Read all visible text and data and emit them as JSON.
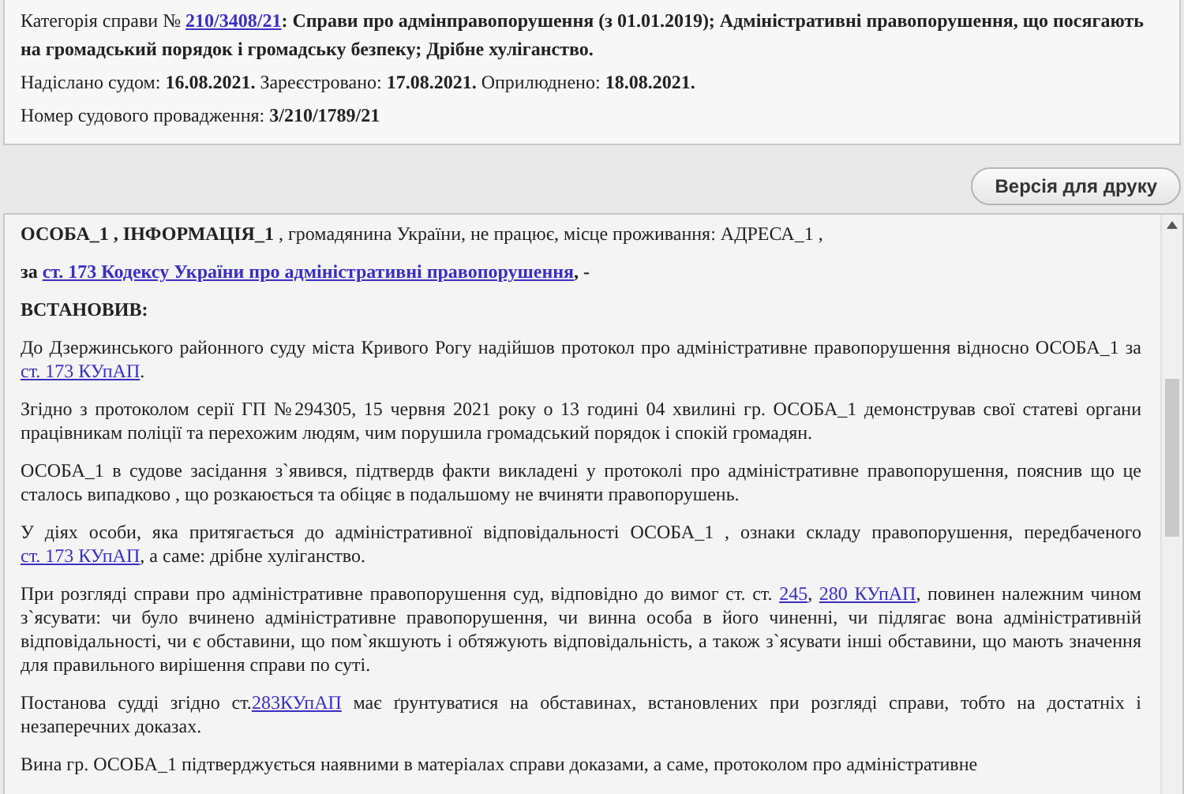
{
  "case_info": {
    "lines": [
      [
        {
          "kind": "text",
          "text": "Категорія справи № "
        },
        {
          "kind": "bold_link",
          "text": "210/3408/21"
        },
        {
          "kind": "bold",
          "text": ": Справи про адмінправопорушення (з 01.01.2019); Адміністративні правопорушення, що посягають на громадський порядок і громадську безпеку; Дрібне хуліганство."
        }
      ],
      [
        {
          "kind": "text",
          "text": "Надіслано судом: "
        },
        {
          "kind": "bold",
          "text": "16.08.2021."
        },
        {
          "kind": "text",
          "text": " Зареєстровано: "
        },
        {
          "kind": "bold",
          "text": "17.08.2021."
        },
        {
          "kind": "text",
          "text": " Оприлюднено: "
        },
        {
          "kind": "bold",
          "text": "18.08.2021."
        }
      ],
      [
        {
          "kind": "text",
          "text": "Номер судового провадження: "
        },
        {
          "kind": "bold",
          "text": "3/210/1789/21"
        }
      ]
    ]
  },
  "print_button": {
    "label": "Версія для друку"
  },
  "document": {
    "paragraphs": [
      [
        {
          "kind": "bold",
          "text": "ОСОБА_1 , ІНФОРМАЦІЯ_1"
        },
        {
          "kind": "text",
          "text": " , громадянина України, не працює, місце проживання: АДРЕСА_1 ,"
        }
      ],
      [
        {
          "kind": "bold",
          "text": "за "
        },
        {
          "kind": "bold_link",
          "text": "ст. 173 Кодексу України про адміністративні правопорушення"
        },
        {
          "kind": "bold",
          "text": ", -"
        }
      ],
      [
        {
          "kind": "bold",
          "text": "ВСТАНОВИВ:"
        }
      ],
      [
        {
          "kind": "text",
          "text": "До Дзержинського районного суду міста Кривого Рогу надійшов протокол про адміністративне правопорушення відносно ОСОБА_1 за "
        },
        {
          "kind": "link",
          "text": "ст. 173 КУпАП"
        },
        {
          "kind": "text",
          "text": "."
        }
      ],
      [
        {
          "kind": "text",
          "text": "Згідно з протоколом серії ГП №294305, 15 червня 2021 року о 13 годині 04 хвилині гр. ОСОБА_1 демонстрував свої статеві органи працівникам поліції та перехожим людям, чим порушила громадський порядок і спокій громадян."
        }
      ],
      [
        {
          "kind": "text",
          "text": "ОСОБА_1 в судове засідання з`явився, підтвердв факти викладені у протоколі про адміністративне правопорушення, пояснив що це сталось випадково , що розкаюється та обіцяє в подальшому не вчиняти правопорушень."
        }
      ],
      [
        {
          "kind": "text",
          "text": "У діях особи, яка притягається до адміністративної відповідальності ОСОБА_1 , ознаки складу правопорушення, передбаченого "
        },
        {
          "kind": "link",
          "text": "ст. 173 КУпАП"
        },
        {
          "kind": "text",
          "text": ", а саме: дрібне хуліганство."
        }
      ],
      [
        {
          "kind": "text",
          "text": "При розгляді справи про адміністративне правопорушення суд, відповідно до вимог ст. ст. "
        },
        {
          "kind": "link",
          "text": "245"
        },
        {
          "kind": "text",
          "text": ", "
        },
        {
          "kind": "link",
          "text": "280 КУпАП"
        },
        {
          "kind": "text",
          "text": ", повинен належним чином з`ясувати: чи було вчинено адміністративне правопорушення, чи винна особа в його чиненні, чи підлягає вона адміністративній відповідальності, чи є обставини, що пом`якшують і обтяжують відповідальність, а також з`ясувати інші обставини, що мають значення для правильного вирішення справи по суті."
        }
      ],
      [
        {
          "kind": "text",
          "text": "Постанова судді згідно ст."
        },
        {
          "kind": "link",
          "text": "283КУпАП"
        },
        {
          "kind": "text",
          "text": " має ґрунтуватися на обставинах, встановлених при розгляді справи, тобто на достатніх і незаперечних доказах."
        }
      ],
      [
        {
          "kind": "text",
          "text": "Вина гр. ОСОБА_1 підтверджується наявними в матеріалах справи доказами, а саме, протоколом про адміністративне"
        }
      ]
    ]
  }
}
